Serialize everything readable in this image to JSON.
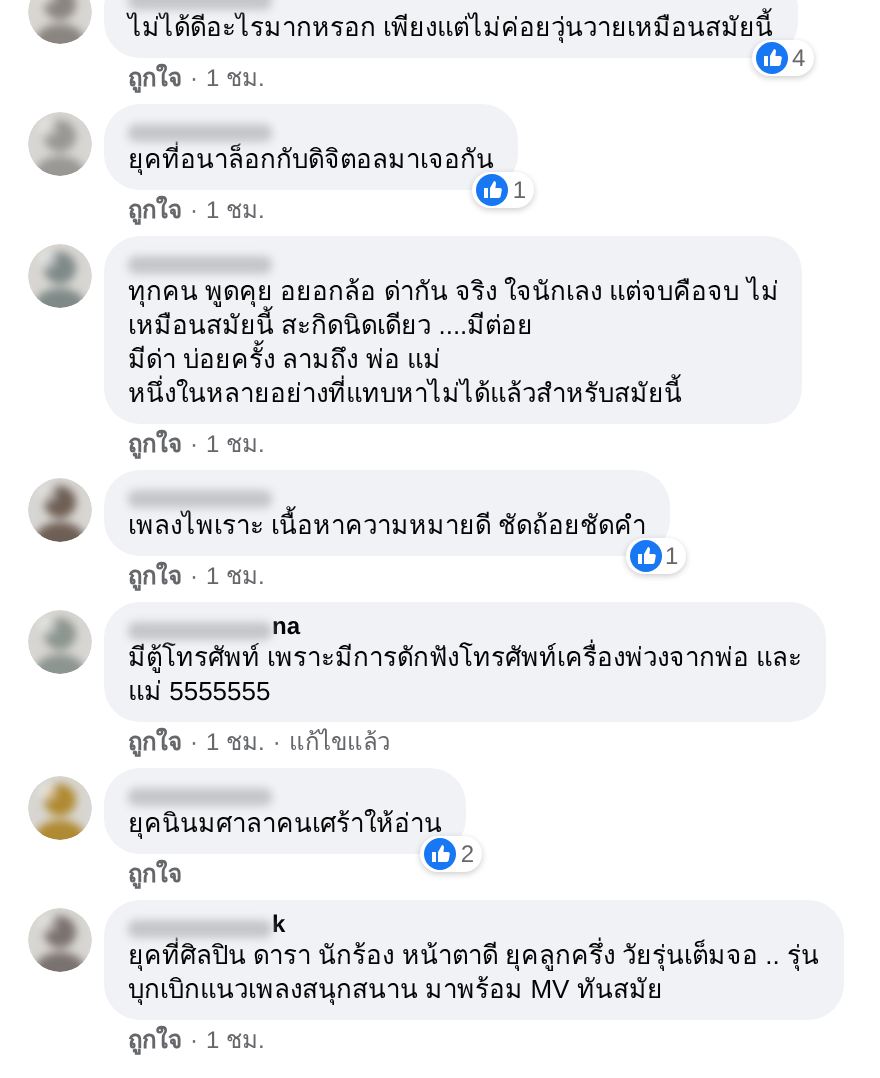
{
  "comments": [
    {
      "text": "ไม่ได้ดีอะไรมากหรอก เพียงแต่ไม่ค่อยวุ่นวายเหมือนสมัยนี้",
      "likes": "4",
      "meta": [
        "ถูกใจ",
        "1 ชม."
      ]
    },
    {
      "text": "ยุคที่อนาล็อกกับดิจิตอลมาเจอกัน",
      "likes": "1",
      "meta": [
        "ถูกใจ",
        "1 ชม."
      ]
    },
    {
      "text": "ทุกคน พูดคุย อยอกล้อ ด่ากัน จริง ใจนักเลง แต่จบคือจบ ไม่\nเหมือนสมัยนี้ สะกิดนิดเดียว ....มีต่อย\nมีด่า บ่อยครั้ง ลามถึง พ่อ แม่\nหนึ่งในหลายอย่างที่แทบหาไม่ได้แล้วสำหรับสมัยนี้",
      "meta": [
        "ถูกใจ",
        "1 ชม."
      ]
    },
    {
      "text": "เพลงไพเราะ เนื้อหาความหมายดี ชัดถ้อยชัดคำ",
      "likes": "1",
      "meta": [
        "ถูกใจ",
        "1 ชม."
      ]
    },
    {
      "name_tail": "na",
      "text": "มีตู้โทรศัพท์ เพราะมีการดักฟังโทรศัพท์เครื่องพ่วงจากพ่อ และ\nแม่ 5555555",
      "meta": [
        "ถูกใจ",
        "1 ชม.",
        "แก้ไขแล้ว"
      ]
    },
    {
      "text": "ยุคนินมศาลาคนเศร้าให้อ่าน",
      "likes": "2",
      "meta": [
        "ถูกใจ"
      ]
    },
    {
      "name_tail": "k",
      "text": "ยุคที่ศิลปิน ดารา นักร้อง หน้าตาดี ยุคลูกครึ่ง วัยรุ่นเต็มจอ .. รุ่น\nบุกเบิกแนวเพลงสนุกสนาน มาพร้อม MV ทันสมัย",
      "meta": [
        "ถูกใจ",
        "1 ชม."
      ]
    }
  ],
  "separator": "·"
}
